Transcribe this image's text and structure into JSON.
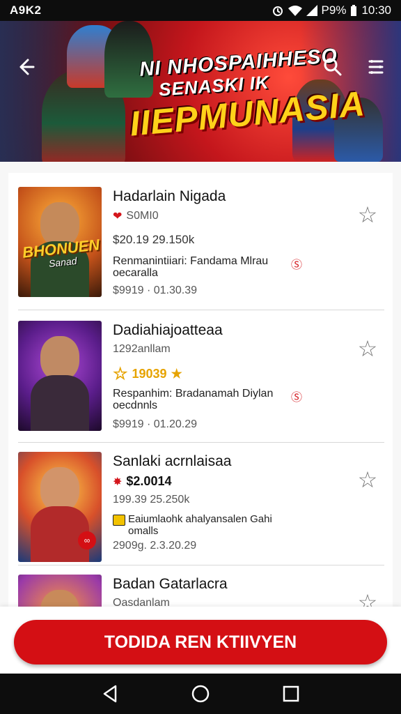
{
  "status_bar": {
    "carrier": "A9K2",
    "battery": "​99%",
    "time": "10:30",
    "battery_text": "P9%"
  },
  "banner": {
    "line1": "NI NHOSPAIHHESO",
    "line2": "SENASKI IK",
    "line3": "IIEPMUNASIA",
    "back_icon": "arrow-left-icon",
    "search_icon": "search-icon",
    "menu_icon": "menu-icon"
  },
  "items": [
    {
      "title": "Hadarlain Nigada",
      "subtitle": "S0MI0",
      "price": "$20.19 29.150k",
      "desc": "Renmanintiiari: Fandama Mlrau\noecaralla",
      "footer": "$9919 · 01.30.39",
      "logo": "BHONUEN",
      "logo_sub": "Sanad"
    },
    {
      "title": "Dadiahiajoatteaa",
      "subtitle": "1292anllam",
      "price": "19039",
      "desc": "Respanhim: Bradanamah Diylan\noecdnnls",
      "footer": "$9919 · 01.20.29"
    },
    {
      "title": "Sanlaki acrnlaisaa",
      "subtitle": "$2.0014",
      "price": "199.39 25.250k",
      "desc": "Eaiumlaohk ahalyansalen Gahi\nomalls",
      "footer": "2909g. 2.3.20.29"
    },
    {
      "title": "Badan Gatarlacra",
      "subtitle": "Oasdanlam"
    }
  ],
  "cta_label": "TODIDA REN KTIIVYEN",
  "colors": {
    "accent": "#d40f14",
    "gold": "#e6a300"
  }
}
